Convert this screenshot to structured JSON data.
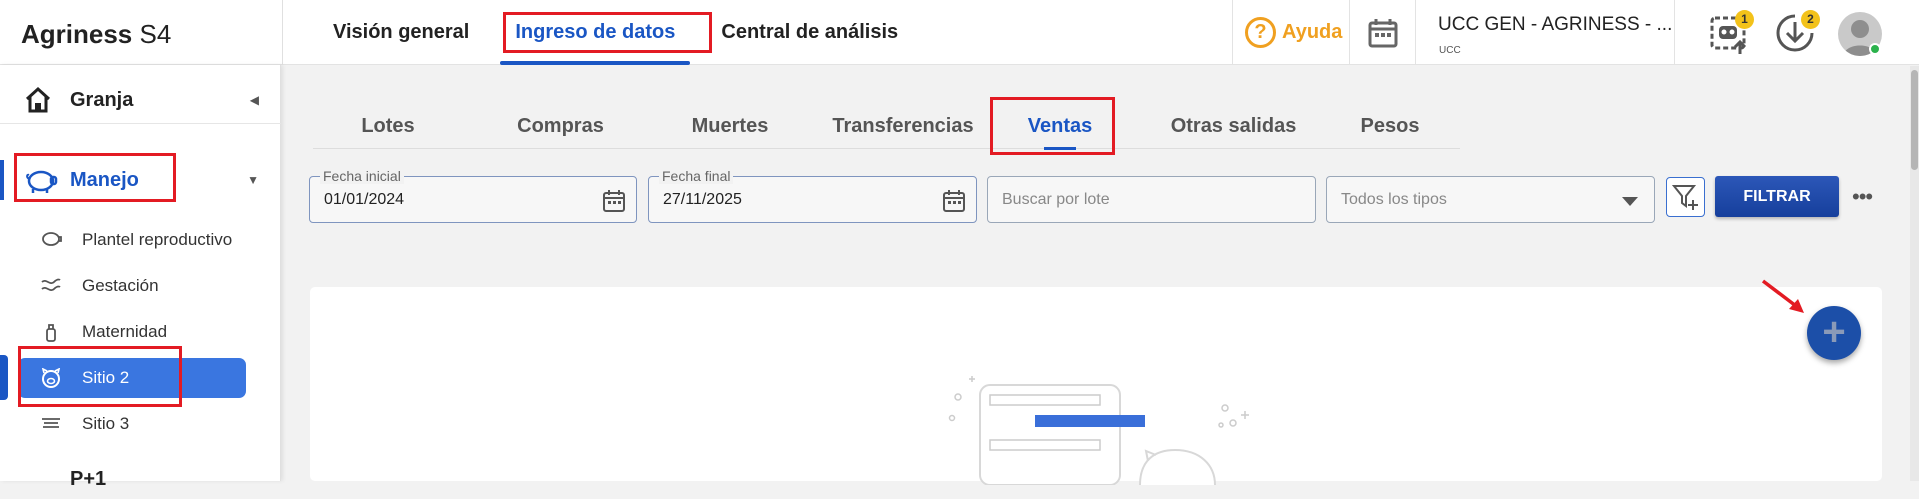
{
  "app": {
    "brand_bold": "Agriness",
    "brand_rest": " S4"
  },
  "main_nav": [
    {
      "label": "Visión general"
    },
    {
      "label": "Ingreso de datos"
    },
    {
      "label": "Central de análisis"
    }
  ],
  "header": {
    "help_label": "Ayuda",
    "org_name": "UCC GEN - AGRINESS - ...",
    "org_sub": "UCC",
    "tasks_badge": "1",
    "downloads_badge": "2"
  },
  "sidebar": {
    "granja": "Granja",
    "manejo": "Manejo",
    "items": [
      {
        "label": "Plantel reproductivo"
      },
      {
        "label": "Gestación"
      },
      {
        "label": "Maternidad"
      },
      {
        "label": "Sitio 2"
      },
      {
        "label": "Sitio 3"
      }
    ],
    "next_section": "P+1"
  },
  "tabs": [
    {
      "label": "Lotes"
    },
    {
      "label": "Compras"
    },
    {
      "label": "Muertes"
    },
    {
      "label": "Transferencias"
    },
    {
      "label": "Ventas"
    },
    {
      "label": "Otras salidas"
    },
    {
      "label": "Pesos"
    }
  ],
  "filters": {
    "start_label": "Fecha inicial",
    "start_value": "01/01/2024",
    "end_label": "Fecha final",
    "end_value": "27/11/2025",
    "search_placeholder": "Buscar por lote",
    "type_value": "Todos los tipos",
    "filter_button": "FILTRAR"
  },
  "colors": {
    "accent": "#1a56c4",
    "help": "#f0a020",
    "highlight": "#e31b23",
    "active_item": "#3a76e0"
  }
}
